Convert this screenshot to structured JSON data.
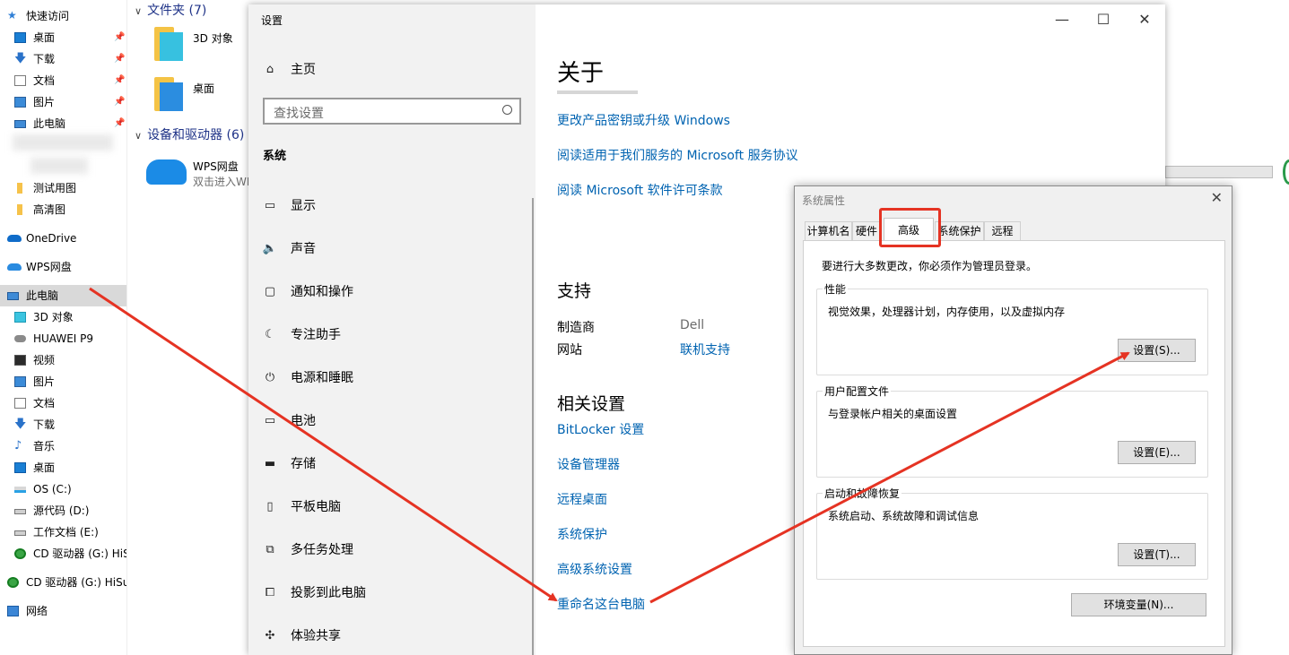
{
  "explorer": {
    "nav": {
      "quick_access": "快速访问",
      "items_pinned": [
        {
          "label": "桌面",
          "icon": "desktop-icon"
        },
        {
          "label": "下载",
          "icon": "download-icon"
        },
        {
          "label": "文档",
          "icon": "document-icon"
        },
        {
          "label": "图片",
          "icon": "pictures-icon"
        },
        {
          "label": "此电脑",
          "icon": "computer-icon"
        }
      ],
      "folders": [
        "测试用图",
        "高清图"
      ],
      "onedrive": "OneDrive",
      "wps": "WPS网盘",
      "this_pc": "此电脑",
      "pc_items": [
        {
          "label": "3D 对象",
          "icon": "3d-objects-icon"
        },
        {
          "label": "HUAWEI P9",
          "icon": "phone-icon"
        },
        {
          "label": "视频",
          "icon": "video-icon"
        },
        {
          "label": "图片",
          "icon": "pictures-icon"
        },
        {
          "label": "文档",
          "icon": "document-icon"
        },
        {
          "label": "下载",
          "icon": "download-icon"
        },
        {
          "label": "音乐",
          "icon": "music-icon"
        },
        {
          "label": "桌面",
          "icon": "desktop-icon"
        },
        {
          "label": "OS (C:)",
          "icon": "os-drive-icon"
        },
        {
          "label": "源代码 (D:)",
          "icon": "drive-icon"
        },
        {
          "label": "工作文档 (E:)",
          "icon": "drive-icon"
        },
        {
          "label": "CD 驱动器 (G:) HiS",
          "icon": "cd-drive-icon"
        }
      ],
      "cd_drive": "CD 驱动器 (G:) HiSu",
      "network": "网络"
    },
    "content": {
      "folders_header": "文件夹 (7)",
      "folder_items": [
        "3D 对象",
        "桌面"
      ],
      "devices_header": "设备和驱动器 (6)",
      "wps_drive": {
        "name": "WPS网盘",
        "sub": "双击进入WI"
      }
    }
  },
  "settings": {
    "window_title": "设置",
    "home": "主页",
    "search_placeholder": "查找设置",
    "section": "系统",
    "nav": [
      {
        "label": "显示",
        "icon": "display-icon"
      },
      {
        "label": "声音",
        "icon": "sound-icon"
      },
      {
        "label": "通知和操作",
        "icon": "notification-icon"
      },
      {
        "label": "专注助手",
        "icon": "moon-icon"
      },
      {
        "label": "电源和睡眠",
        "icon": "power-icon"
      },
      {
        "label": "电池",
        "icon": "battery-icon"
      },
      {
        "label": "存储",
        "icon": "storage-icon"
      },
      {
        "label": "平板电脑",
        "icon": "tablet-icon"
      },
      {
        "label": "多任务处理",
        "icon": "multitask-icon"
      },
      {
        "label": "投影到此电脑",
        "icon": "project-icon"
      },
      {
        "label": "体验共享",
        "icon": "share-icon"
      }
    ],
    "about": {
      "title": "关于",
      "links": [
        "更改产品密钥或升级 Windows",
        "阅读适用于我们服务的 Microsoft 服务协议",
        "阅读 Microsoft 软件许可条款"
      ]
    },
    "support": {
      "title": "支持",
      "manufacturer_label": "制造商",
      "manufacturer_value": "Dell",
      "website_label": "网站",
      "website_value": "联机支持"
    },
    "related": {
      "title": "相关设置",
      "links": [
        "BitLocker 设置",
        "设备管理器",
        "远程桌面",
        "系统保护",
        "高级系统设置",
        "重命名这台电脑"
      ]
    }
  },
  "system_properties": {
    "title": "系统属性",
    "tabs": [
      "计算机名",
      "硬件",
      "高级",
      "系统保护",
      "远程"
    ],
    "active_tab": "高级",
    "admin_note": "要进行大多数更改，你必须作为管理员登录。",
    "groups": [
      {
        "title": "性能",
        "desc": "视觉效果，处理器计划，内存使用，以及虚拟内存",
        "button": "设置(S)..."
      },
      {
        "title": "用户配置文件",
        "desc": "与登录帐户相关的桌面设置",
        "button": "设置(E)..."
      },
      {
        "title": "启动和故障恢复",
        "desc": "系统启动、系统故障和调试信息",
        "button": "设置(T)..."
      }
    ],
    "env_button": "环境变量(N)..."
  },
  "annotation_color": "#e53323"
}
